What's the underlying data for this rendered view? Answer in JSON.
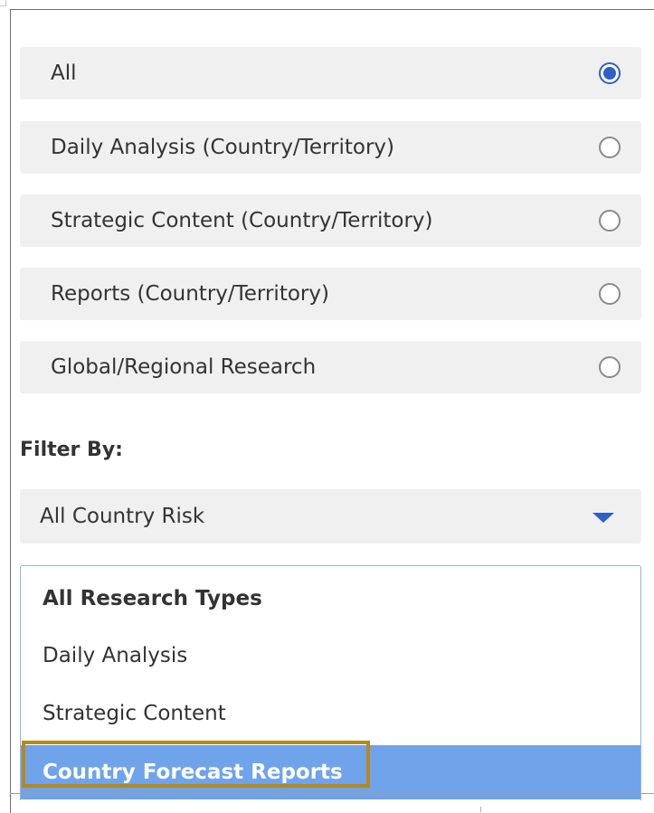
{
  "research_options": [
    {
      "label": "All",
      "checked": true
    },
    {
      "label": "Daily Analysis (Country/Territory)",
      "checked": false
    },
    {
      "label": "Strategic Content (Country/Territory)",
      "checked": false
    },
    {
      "label": "Reports (Country/Territory)",
      "checked": false
    },
    {
      "label": "Global/Regional Research",
      "checked": false
    }
  ],
  "filter": {
    "label": "Filter By:",
    "selected_value": "All Country Risk"
  },
  "dropdown": {
    "items": [
      {
        "label": "All Research Types",
        "style": "bold"
      },
      {
        "label": "Daily Analysis",
        "style": "normal"
      },
      {
        "label": "Strategic Content",
        "style": "normal"
      },
      {
        "label": "Country Forecast Reports",
        "style": "highlighted"
      }
    ]
  },
  "colors": {
    "accent": "#2f5fc8",
    "option_bg": "#f0f0f0",
    "highlight_bg": "#6fa3ea",
    "annotation_border": "#b58a1c"
  }
}
